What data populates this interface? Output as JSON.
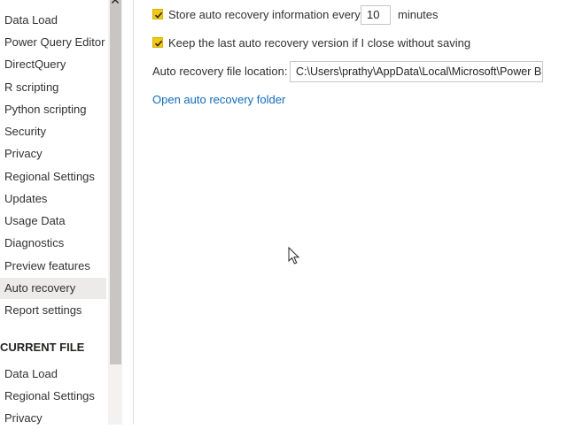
{
  "sidebar": {
    "items": [
      {
        "label": "Data Load"
      },
      {
        "label": "Power Query Editor"
      },
      {
        "label": "DirectQuery"
      },
      {
        "label": "R scripting"
      },
      {
        "label": "Python scripting"
      },
      {
        "label": "Security"
      },
      {
        "label": "Privacy"
      },
      {
        "label": "Regional Settings"
      },
      {
        "label": "Updates"
      },
      {
        "label": "Usage Data"
      },
      {
        "label": "Diagnostics"
      },
      {
        "label": "Preview features"
      },
      {
        "label": "Auto recovery"
      },
      {
        "label": "Report settings"
      }
    ],
    "active_item": "Auto recovery",
    "current_file_header": "CURRENT FILE",
    "current_file_items": [
      {
        "label": "Data Load"
      },
      {
        "label": "Regional Settings"
      },
      {
        "label": "Privacy"
      }
    ]
  },
  "close_glyph": "✕",
  "main": {
    "store_recovery": {
      "checked": true,
      "label": "Store auto recovery information every",
      "minutes_value": "10",
      "unit_label": "minutes"
    },
    "keep_last_version": {
      "checked": true,
      "label": "Keep the last auto recovery version if I close without saving"
    },
    "location": {
      "label": "Auto recovery file location:",
      "value": "C:\\Users\\prathy\\AppData\\Local\\Microsoft\\Power BI Desktop\\AutoRecovery"
    },
    "open_folder_link": "Open auto recovery folder"
  },
  "colors": {
    "checkbox": "#f2c811",
    "link": "#0f6cbd",
    "active_bg": "#edebe9"
  }
}
